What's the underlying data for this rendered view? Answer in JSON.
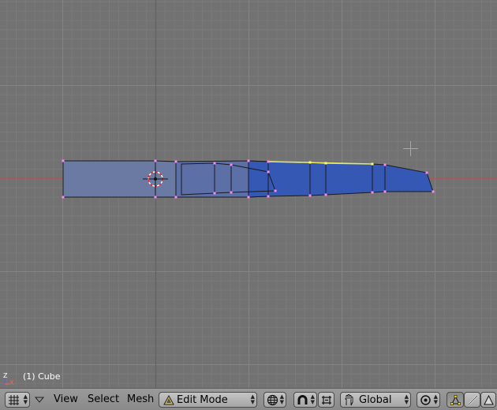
{
  "viewport": {
    "object_label": "(1) Cube",
    "axis_labels": {
      "z": "Z",
      "x": "X"
    },
    "colors": {
      "background": "#727272",
      "grid_line": "#7e7e7e",
      "major_grid_line": "#878787",
      "x_axis": "#a05a5a",
      "z_axis": "#5a4ec0",
      "mesh_selected_face": "#3355bb",
      "mesh_face": "#6a7aa0",
      "vertex": "#ff88ff",
      "selected_edge": "#ffff88",
      "cursor": "#ff0000"
    }
  },
  "toolbar": {
    "window_type_icon": "grid-icon",
    "menu_collapse_icon": "triangle-down-icon",
    "menus": [
      "View",
      "Select",
      "Mesh"
    ],
    "mode": {
      "label": "Edit Mode",
      "icon": "mode-triangle-icon"
    },
    "draw_type_icon": "globe-icon",
    "snap_icon": "magnet-icon",
    "snap_mode_icon": "snap-element-icon",
    "manipulator_icon": "hand-icon",
    "orientation": {
      "label": "Global"
    },
    "pivot_icon": "pivot-icon",
    "select_modes": [
      "vertex-select-icon",
      "edge-select-icon",
      "face-select-icon"
    ]
  }
}
